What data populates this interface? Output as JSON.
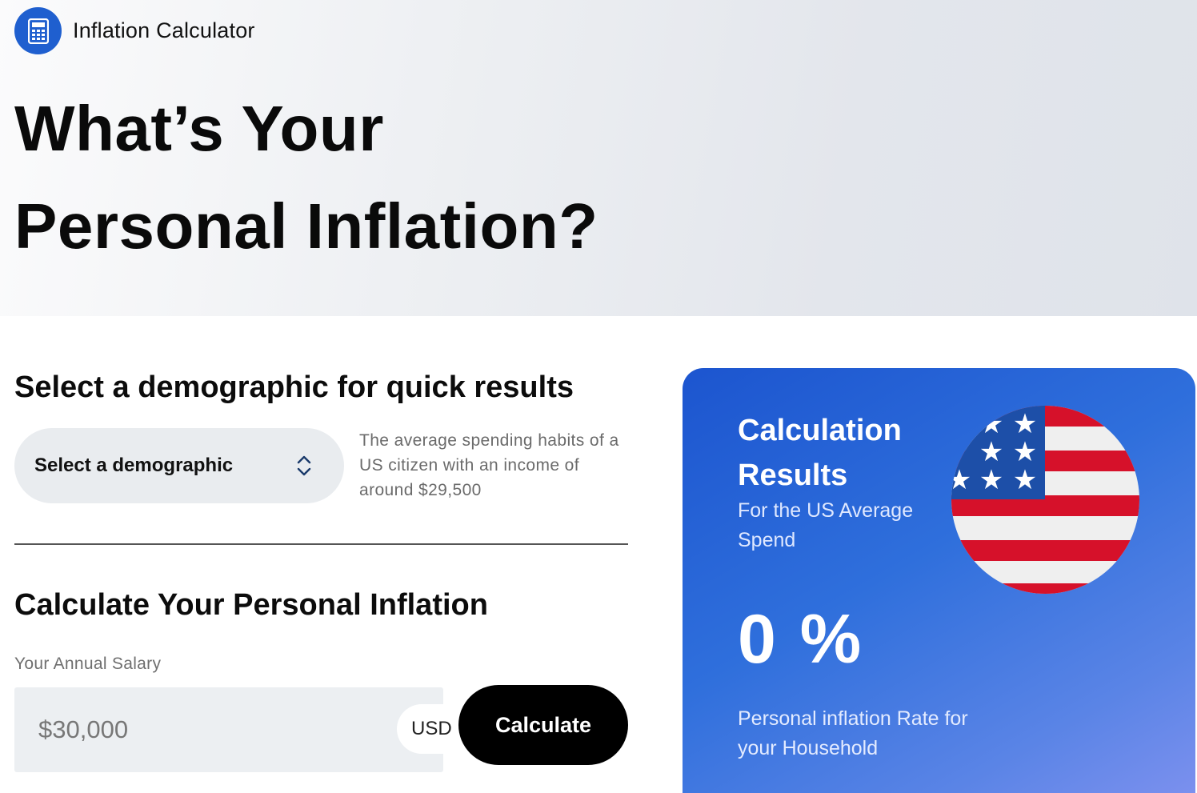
{
  "app": {
    "name": "Inflation Calculator"
  },
  "hero": {
    "title_line1": "What’s Your",
    "title_line2": "Personal Inflation?"
  },
  "quick": {
    "heading": "Select a demographic for quick results",
    "select_label": "Select a demographic",
    "note": "The average spending habits of a US citizen with an income of around $29,500"
  },
  "calculator": {
    "heading": "Calculate Your Personal Inflation",
    "salary_label": "Your Annual Salary",
    "salary_placeholder": "$30,000",
    "currency": "USD",
    "button_label": "Calculate"
  },
  "results": {
    "title_line1": "Calculation",
    "title_line2": "Results",
    "subtitle": "For the US Average Spend",
    "rate": "0 %",
    "caption": "Personal inflation Rate for your Household"
  },
  "colors": {
    "brand": "#1f5fcf",
    "card_start": "#1c55cf",
    "card_end": "#7b90ee",
    "button": "#000000"
  },
  "icons": {
    "logo": "calculator-icon",
    "select": "chevron-up-down-icon",
    "flag": "us-flag-icon"
  }
}
